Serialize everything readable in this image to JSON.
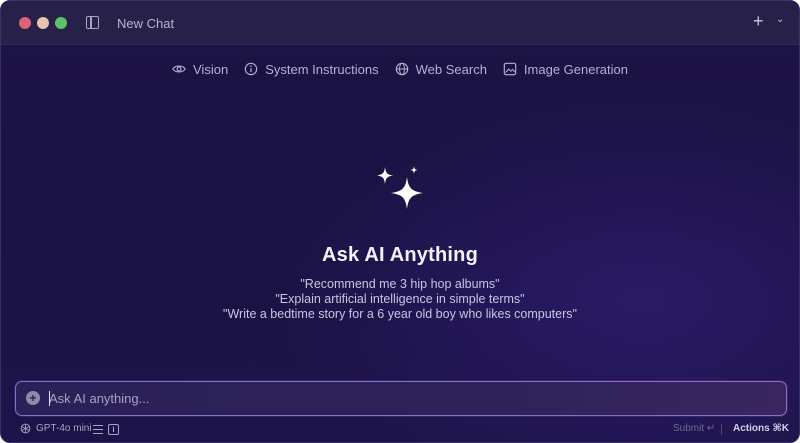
{
  "window": {
    "title": "New Chat"
  },
  "features": [
    {
      "label": "Vision",
      "icon": "eye-icon"
    },
    {
      "label": "System Instructions",
      "icon": "info-icon"
    },
    {
      "label": "Web Search",
      "icon": "globe-icon"
    },
    {
      "label": "Image Generation",
      "icon": "image-icon"
    }
  ],
  "hero": {
    "title": "Ask AI Anything",
    "suggestions": [
      "\"Recommend me 3 hip hop albums\"",
      "\"Explain artificial intelligence in simple terms\"",
      "\"Write a bedtime story for a 6 year old boy who likes computers\""
    ]
  },
  "input": {
    "placeholder": "Ask AI anything...",
    "value": ""
  },
  "footer": {
    "model": "GPT-4o mini",
    "submit_label": "Submit ↵",
    "actions_label": "Actions ⌘K"
  },
  "colors": {
    "background": "#1b1344",
    "accent": "#8b6ec9",
    "close": "#d9647a",
    "minimize": "#e7c3b0",
    "maximize": "#5ec26a"
  }
}
